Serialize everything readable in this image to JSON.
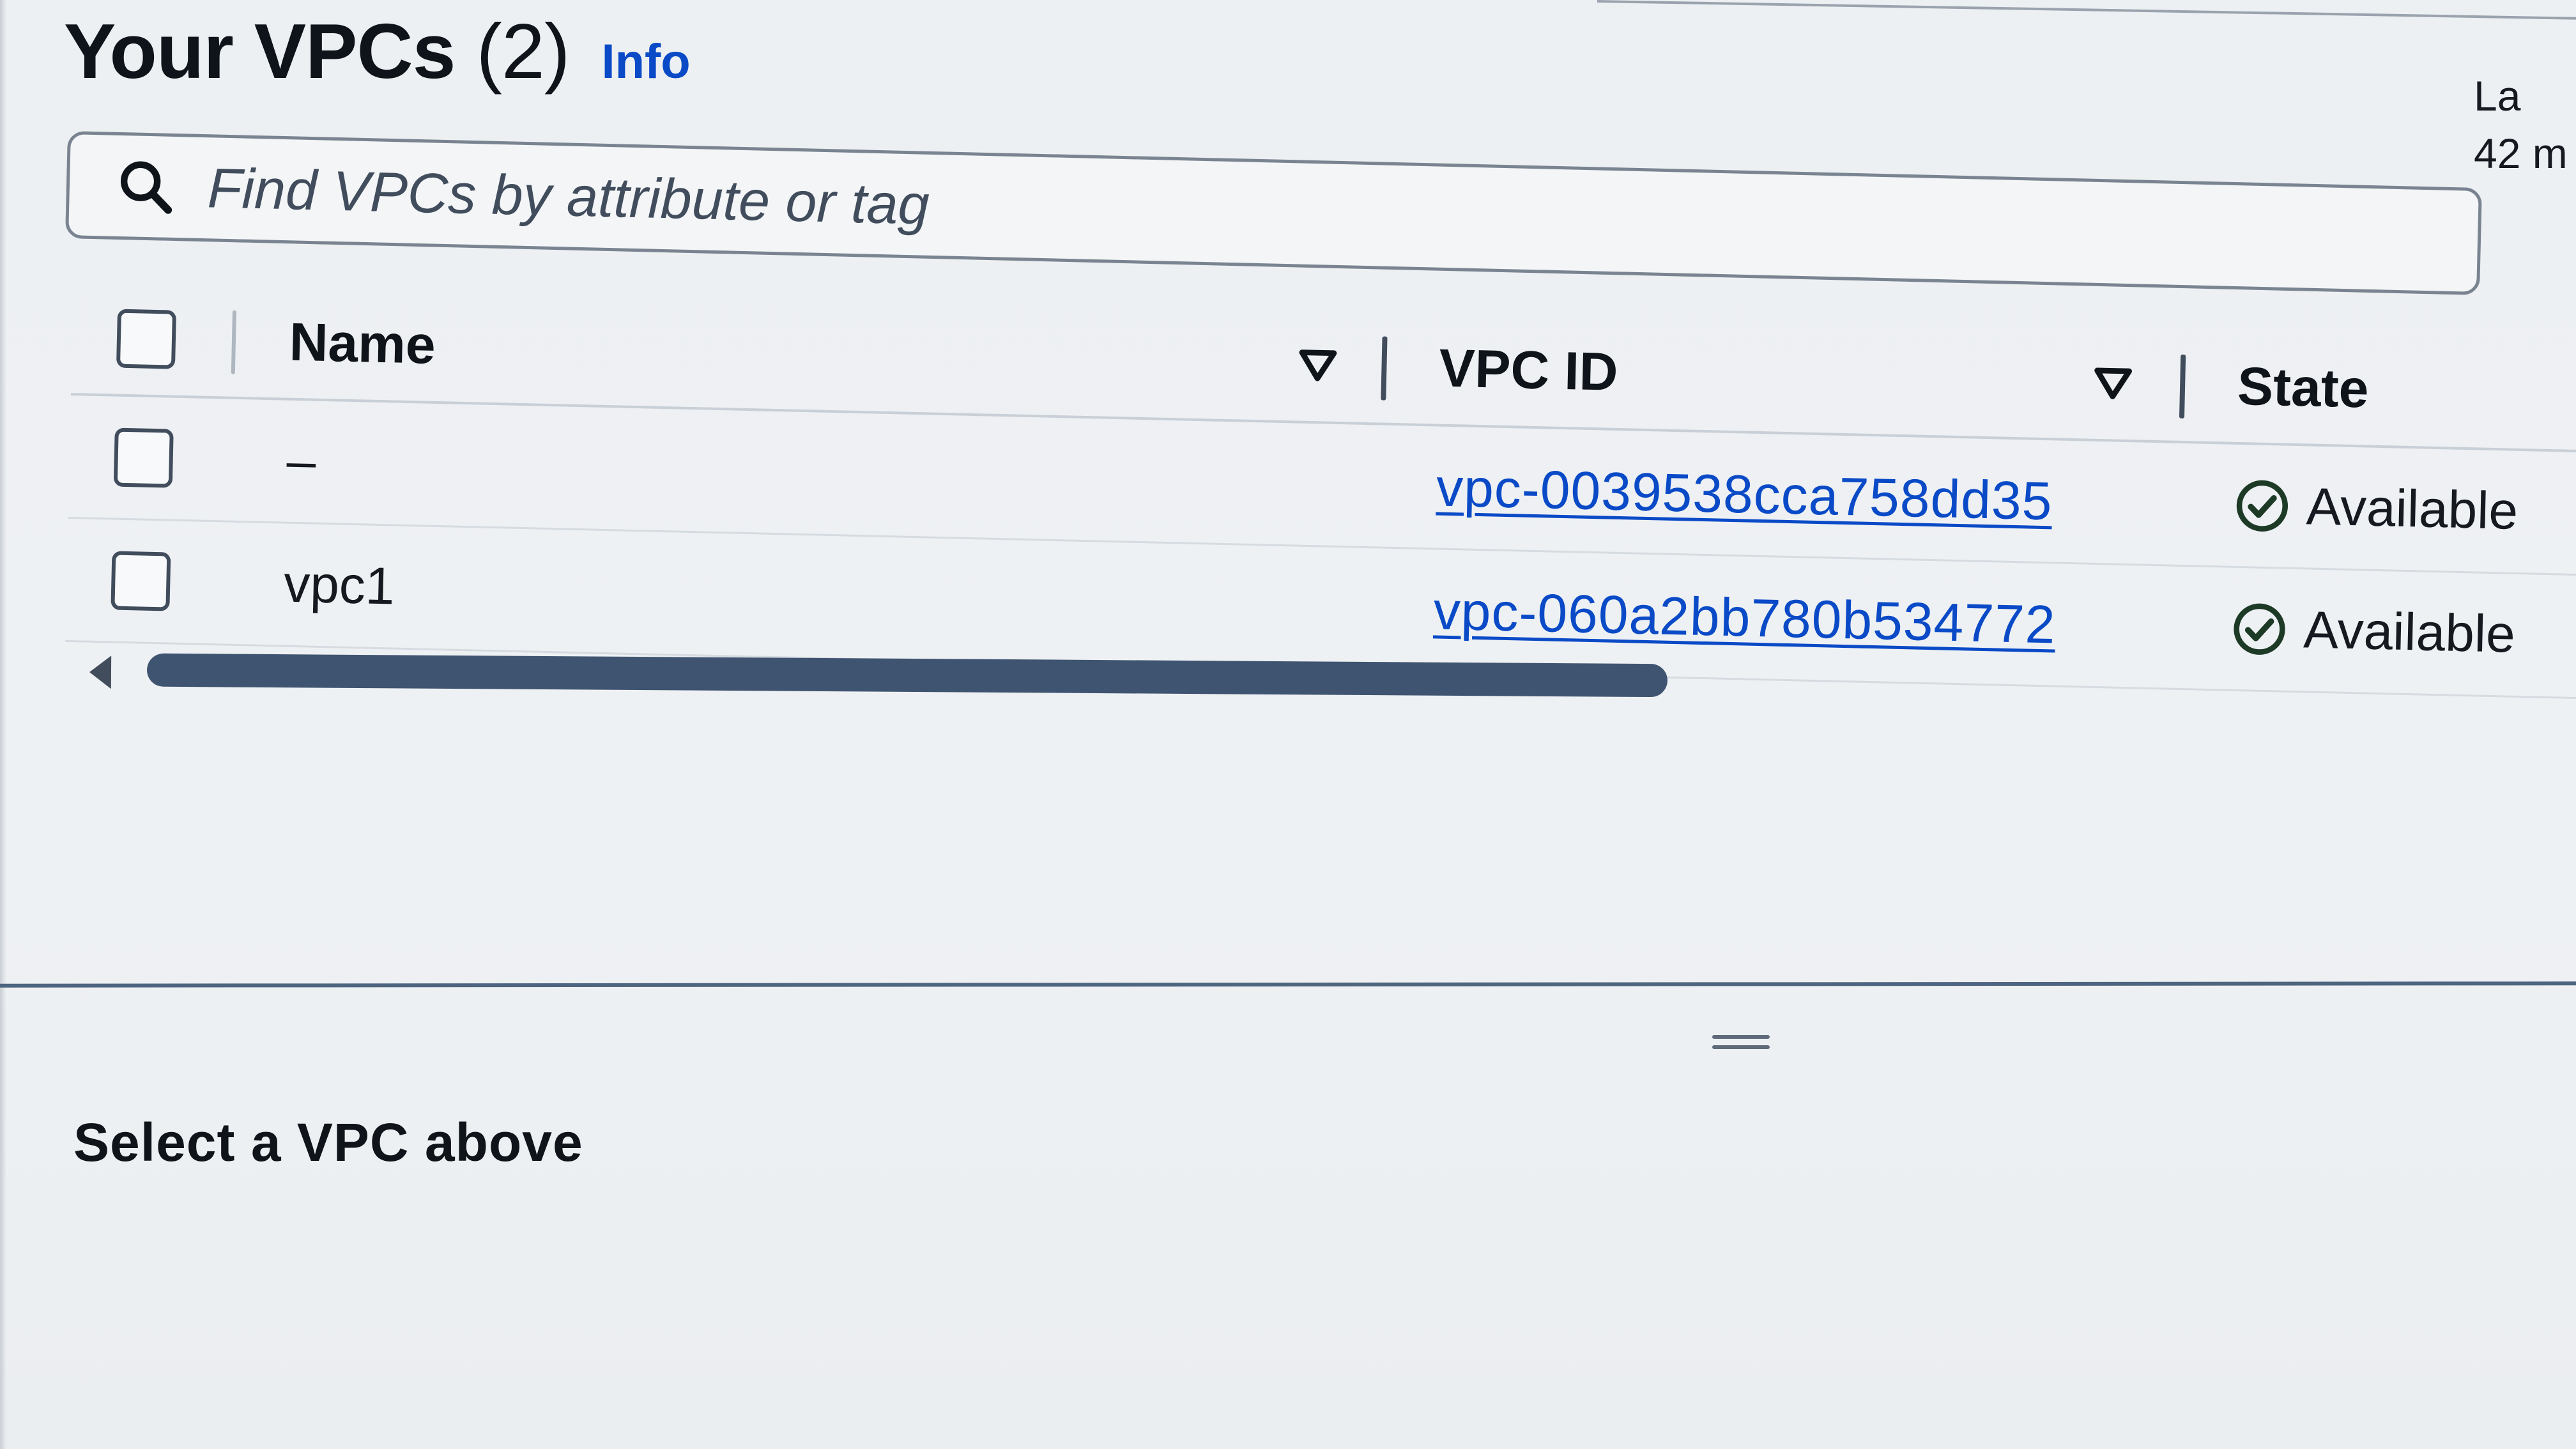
{
  "header": {
    "title": "Your VPCs",
    "count": "(2)",
    "info_label": "Info",
    "last_updated_line1": "La",
    "last_updated_line2": "42 m"
  },
  "search": {
    "placeholder": "Find VPCs by attribute or tag",
    "value": ""
  },
  "table": {
    "columns": [
      {
        "label": "Name"
      },
      {
        "label": "VPC ID"
      },
      {
        "label": "State"
      }
    ],
    "rows": [
      {
        "name": "–",
        "vpc_id": "vpc-0039538cca758dd35",
        "state": "Available"
      },
      {
        "name": "vpc1",
        "vpc_id": "vpc-060a2bb780b534772",
        "state": "Available"
      }
    ]
  },
  "split_panel": {
    "message": "Select a VPC above"
  },
  "icons": {
    "search": "search-icon",
    "sort": "caret-down-icon",
    "status": "status-positive-icon",
    "scroll_left": "caret-left-icon",
    "resize": "drag-handle-icon"
  },
  "colors": {
    "link": "#0a4ac7",
    "status_success": "#1d3a26",
    "scroll_thumb": "#3f5470",
    "split_line": "#4e6580"
  }
}
